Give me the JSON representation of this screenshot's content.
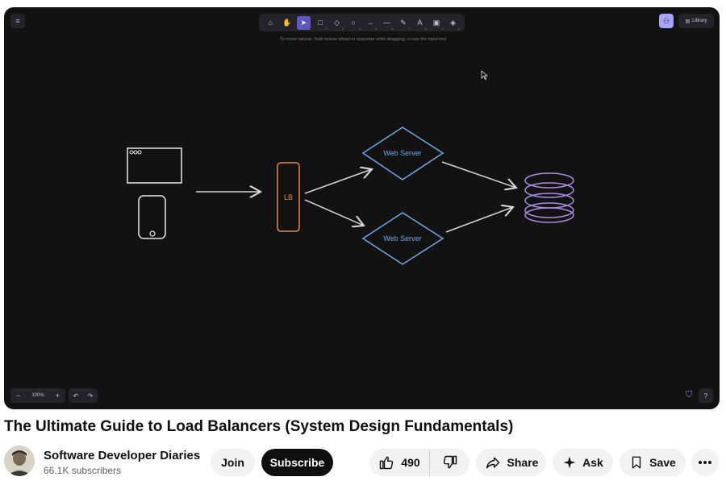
{
  "canvas": {
    "hint": "To move canvas, hold mouse wheel or spacebar while dragging, or use the hand tool",
    "library_label": "Library",
    "zoom_level": "100%",
    "tool_icons": [
      "lock-icon",
      "hand-icon",
      "pointer-icon",
      "rectangle-icon",
      "diamond-icon",
      "ellipse-icon",
      "arrow-icon",
      "line-icon",
      "pencil-icon",
      "text-icon",
      "image-icon",
      "eraser-icon"
    ],
    "tool_keys": [
      "",
      "",
      "1",
      "2",
      "3",
      "4",
      "5",
      "6",
      "7",
      "8",
      "9",
      "0"
    ],
    "active_tool": "pointer-icon",
    "accent_color": "#a8a5ff"
  },
  "diagram": {
    "lb_label": "LB",
    "server_top_label": "Web Server",
    "server_bottom_label": "Web Server",
    "colors": {
      "lb": "#e48a4b",
      "server": "#6fa8e6",
      "db": "#a98de0",
      "client": "#e8e8e8",
      "arrow": "#d8d8d8"
    }
  },
  "video": {
    "title": "The Ultimate Guide to Load Balancers (System Design Fundamentals)",
    "channel_name": "Software Developer Diaries",
    "subscribers": "66.1K subscribers",
    "join_label": "Join",
    "subscribe_label": "Subscribe",
    "likes": "490",
    "share_label": "Share",
    "ask_label": "Ask",
    "save_label": "Save"
  }
}
